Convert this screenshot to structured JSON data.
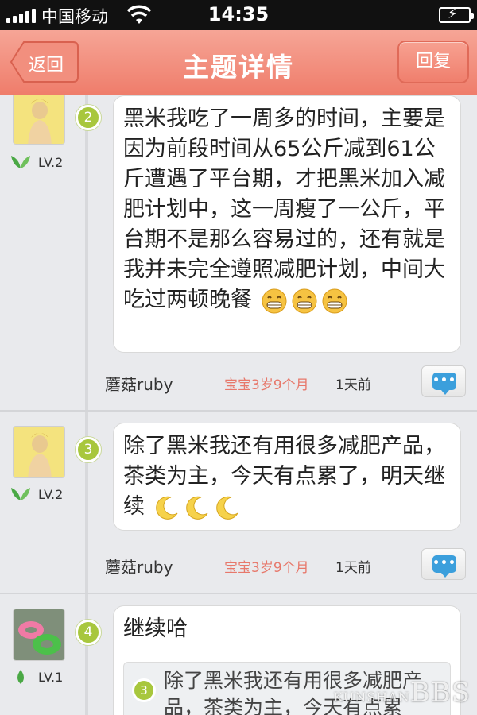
{
  "status_bar": {
    "carrier": "中国移动",
    "time": "14:35"
  },
  "nav": {
    "title": "主题详情",
    "back_label": "返回",
    "reply_label": "回复"
  },
  "posts": [
    {
      "floor": "2",
      "level": "LV.2",
      "text": "黑米我吃了一周多的时间，主要是因为前段时间从65公斤减到61公斤遭遇了平台期，才把黑米加入减肥计划中，这一周瘦了一公斤，平台期不是那么容易过的，还有就是我并未完全遵照减肥计划，中间大吃过两顿晚餐",
      "emoji": [
        "grin-emoji",
        "grin-emoji",
        "grin-emoji"
      ],
      "user": "蘑菇ruby",
      "baby_age": "宝宝3岁9个月",
      "time_ago": "1天前"
    },
    {
      "floor": "3",
      "level": "LV.2",
      "text": "除了黑米我还有用很多减肥产品，茶类为主，今天有点累了，明天继续",
      "emoji": [
        "moon-emoji",
        "moon-emoji",
        "moon-emoji"
      ],
      "user": "蘑菇ruby",
      "baby_age": "宝宝3岁9个月",
      "time_ago": "1天前"
    },
    {
      "floor": "4",
      "level": "LV.1",
      "text": "继续哈",
      "quote": {
        "floor": "3",
        "text": "除了黑米我还有用很多减肥产品，茶类为主，今天有点累"
      }
    }
  ],
  "watermark": {
    "small": "KUNSHAN",
    "big": "BBS"
  },
  "colors": {
    "nav_top": "#f6a596",
    "nav_bottom": "#ef7d6b",
    "floor_badge": "#a8c73d",
    "baby_age": "#e7786b",
    "comment_icon": "#3b9fdc"
  }
}
